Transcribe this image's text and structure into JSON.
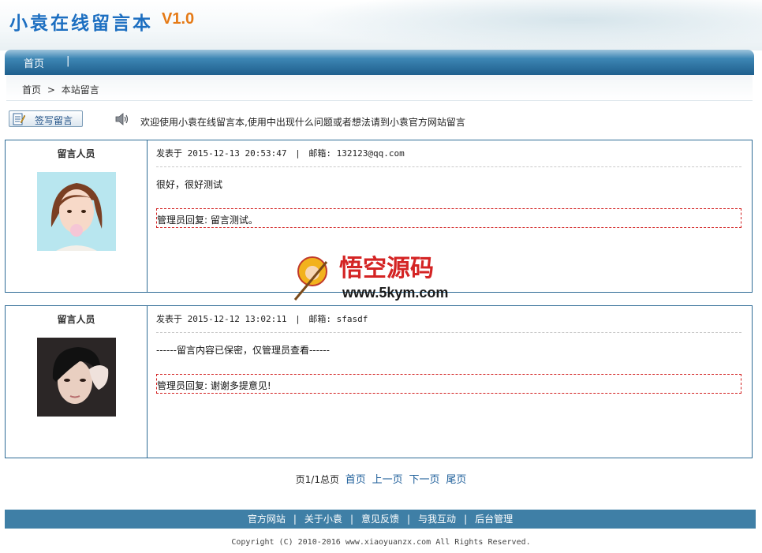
{
  "header": {
    "title": "小袁在线留言本",
    "version": "V1.0",
    "colors": {
      "title": "#1d6fc1",
      "version": "#e57a16",
      "nav": "#2f6c96"
    }
  },
  "nav": {
    "home": "首页",
    "separator": "|"
  },
  "breadcrumb": {
    "home": "首页",
    "arrow": ">",
    "current": "本站留言"
  },
  "toolbar": {
    "write_button": "签写留言",
    "welcome": "欢迎使用小袁在线留言本,使用中出现什么问题或者想法请到小袁官方网站留言"
  },
  "messages": [
    {
      "author_label": "留言人员",
      "posted_prefix": "发表于",
      "posted_at": "2015-12-13 20:53:47",
      "email_label": "邮箱:",
      "email": "132123@qq.com",
      "content": "很好，很好测试",
      "reply_label": "管理员回复:",
      "reply": "留言测试。",
      "avatar": "female-avatar"
    },
    {
      "author_label": "留言人员",
      "posted_prefix": "发表于",
      "posted_at": "2015-12-12 13:02:11",
      "email_label": "邮箱:",
      "email": "sfasdf",
      "content": "------留言内容已保密，仅管理员查看------",
      "reply_label": "管理员回复:",
      "reply": "谢谢多提意见!",
      "avatar": "male-avatar"
    }
  ],
  "watermark": {
    "title": "悟空源码",
    "url": "www.5kym.com"
  },
  "pagination": {
    "info": "页1/1总页",
    "first": "首页",
    "prev": "上一页",
    "next": "下一页",
    "last": "尾页"
  },
  "footer": {
    "links": [
      "官方网站",
      "关于小袁",
      "意见反馈",
      "与我互动",
      "后台管理"
    ],
    "copyright": "Copyright (C) 2010-2016 www.xiaoyuanzx.com All Rights Reserved."
  }
}
